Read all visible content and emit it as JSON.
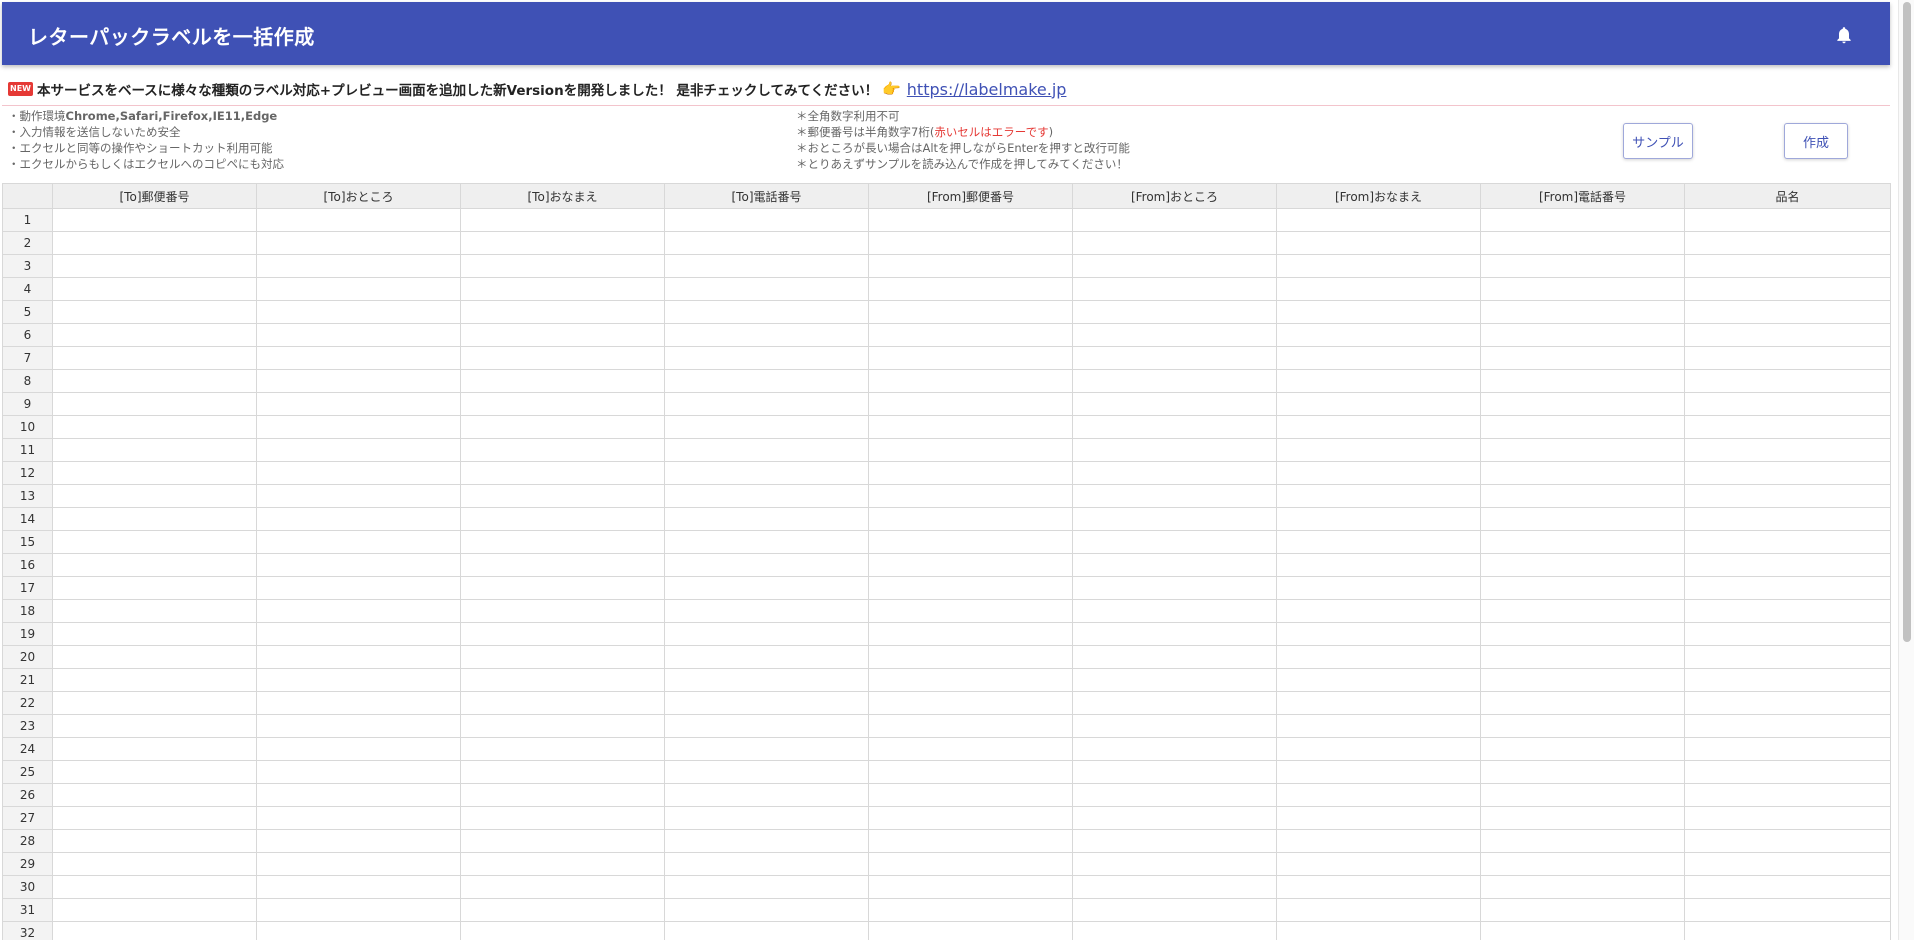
{
  "header": {
    "title": "レターパックラベルを一括作成",
    "bell_icon": "bell-icon"
  },
  "announcement": {
    "badge": "NEW",
    "text": "本サービスをベースに様々な種類のラベル対応+プレビュー画面を追加した新Versionを開発しました！ 是非チェックしてみてください！",
    "pointer_icon": "👉",
    "link_text": "https://labelmake.jp"
  },
  "notes_left": {
    "line1_prefix": "・動作環境",
    "line1_bold": "Chrome,Safari,Firefox,IE11,Edge",
    "line2": "・入力情報を送信しないため安全",
    "line3": "・エクセルと同等の操作やショートカット利用可能",
    "line4": "・エクセルからもしくはエクセルへのコピペにも対応"
  },
  "notes_right": {
    "line1": "＊全角数字利用不可",
    "line2_prefix": "＊郵便番号は半角数字7桁(",
    "line2_red": "赤いセルはエラーです",
    "line2_suffix": ")",
    "line3": "＊おところが長い場合はAltを押しながらEnterを押すと改行可能",
    "line4": "＊とりあえずサンプルを読み込んで作成を押してみてください！"
  },
  "buttons": {
    "sample": "サンプル",
    "create": "作成"
  },
  "grid": {
    "columns": [
      "[To]郵便番号",
      "[To]おところ",
      "[To]おなまえ",
      "[To]電話番号",
      "[From]郵便番号",
      "[From]おところ",
      "[From]おなまえ",
      "[From]電話番号",
      "品名"
    ],
    "rows": [
      "1",
      "2",
      "3",
      "4",
      "5",
      "6",
      "7",
      "8",
      "9",
      "10",
      "11",
      "12",
      "13",
      "14",
      "15",
      "16",
      "17",
      "18",
      "19",
      "20",
      "21",
      "22",
      "23",
      "24",
      "25",
      "26",
      "27",
      "28",
      "29",
      "30",
      "31",
      "32"
    ]
  },
  "colors": {
    "header_bg": "#3f51b5",
    "accent": "#3f51b5",
    "error_red": "#e53935"
  }
}
